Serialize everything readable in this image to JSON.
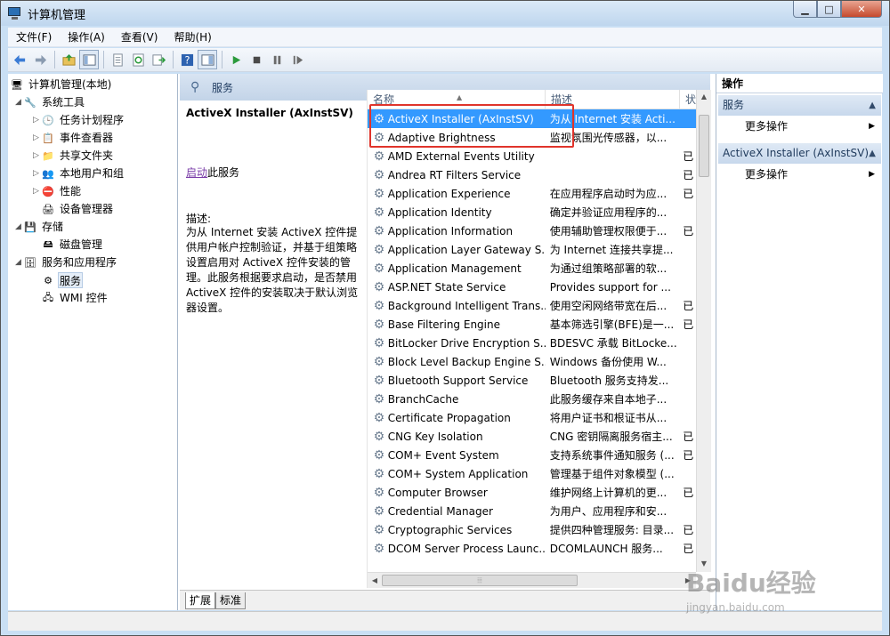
{
  "window": {
    "title": "计算机管理",
    "min_icon": "minimize-icon",
    "max_icon": "maximize-icon",
    "close_icon": "close-icon"
  },
  "menu": [
    "文件(F)",
    "操作(A)",
    "查看(V)",
    "帮助(H)"
  ],
  "toolbar_icons": [
    "back-icon",
    "forward-icon",
    "up-folder-icon",
    "show-tree-icon",
    "properties-icon",
    "refresh-icon",
    "export-icon",
    "help-icon",
    "view-icon",
    "start-service-icon",
    "stop-service-icon",
    "pause-service-icon",
    "restart-service-icon"
  ],
  "tree": {
    "root": "计算机管理(本地)",
    "items": [
      {
        "label": "系统工具",
        "icon": "tools-icon"
      },
      {
        "label": "任务计划程序",
        "icon": "clock-icon"
      },
      {
        "label": "事件查看器",
        "icon": "event-viewer-icon"
      },
      {
        "label": "共享文件夹",
        "icon": "shared-folder-icon"
      },
      {
        "label": "本地用户和组",
        "icon": "users-icon"
      },
      {
        "label": "性能",
        "icon": "performance-icon"
      },
      {
        "label": "设备管理器",
        "icon": "device-manager-icon"
      },
      {
        "label": "存储",
        "icon": "storage-icon"
      },
      {
        "label": "磁盘管理",
        "icon": "disk-icon"
      },
      {
        "label": "服务和应用程序",
        "icon": "services-apps-icon"
      },
      {
        "label": "服务",
        "icon": "services-icon"
      },
      {
        "label": "WMI 控件",
        "icon": "wmi-icon"
      }
    ]
  },
  "services_header": "服务",
  "description": {
    "title": "ActiveX Installer (AxInstSV)",
    "start_link": "启动",
    "start_suffix": "此服务",
    "label": "描述:",
    "body": "为从 Internet 安装 ActiveX 控件提供用户帐户控制验证，并基于组策略设置启用对 ActiveX 控件安装的管理。此服务根据要求启动，是否禁用 ActiveX 控件的安装取决于默认浏览器设置。"
  },
  "columns": {
    "name": "名称",
    "desc": "描述",
    "status": "状"
  },
  "services": [
    {
      "name": "ActiveX Installer (AxInstSV)",
      "desc": "为从 Internet 安装 Acti...",
      "status": ""
    },
    {
      "name": "Adaptive Brightness",
      "desc": "监视氛围光传感器，以...",
      "status": ""
    },
    {
      "name": "AMD External Events Utility",
      "desc": "",
      "status": "已"
    },
    {
      "name": "Andrea RT Filters Service",
      "desc": "",
      "status": "已"
    },
    {
      "name": "Application Experience",
      "desc": "在应用程序启动时为应...",
      "status": "已"
    },
    {
      "name": "Application Identity",
      "desc": "确定并验证应用程序的...",
      "status": ""
    },
    {
      "name": "Application Information",
      "desc": "使用辅助管理权限便于...",
      "status": "已"
    },
    {
      "name": "Application Layer Gateway S...",
      "desc": "为 Internet 连接共享提...",
      "status": ""
    },
    {
      "name": "Application Management",
      "desc": "为通过组策略部署的软...",
      "status": ""
    },
    {
      "name": "ASP.NET State Service",
      "desc": "Provides support for ...",
      "status": ""
    },
    {
      "name": "Background Intelligent Trans...",
      "desc": "使用空闲网络带宽在后...",
      "status": "已"
    },
    {
      "name": "Base Filtering Engine",
      "desc": "基本筛选引擎(BFE)是一...",
      "status": "已"
    },
    {
      "name": "BitLocker Drive Encryption S...",
      "desc": "BDESVC 承载 BitLocke...",
      "status": ""
    },
    {
      "name": "Block Level Backup Engine S...",
      "desc": "Windows 备份使用 W...",
      "status": ""
    },
    {
      "name": "Bluetooth Support Service",
      "desc": "Bluetooth 服务支持发...",
      "status": ""
    },
    {
      "name": "BranchCache",
      "desc": "此服务缓存来自本地子...",
      "status": ""
    },
    {
      "name": "Certificate Propagation",
      "desc": "将用户证书和根证书从...",
      "status": ""
    },
    {
      "name": "CNG Key Isolation",
      "desc": "CNG 密钥隔离服务宿主...",
      "status": "已"
    },
    {
      "name": "COM+ Event System",
      "desc": "支持系统事件通知服务 (...",
      "status": "已"
    },
    {
      "name": "COM+ System Application",
      "desc": "管理基于组件对象模型 (...",
      "status": ""
    },
    {
      "name": "Computer Browser",
      "desc": "维护网络上计算机的更...",
      "status": "已"
    },
    {
      "name": "Credential Manager",
      "desc": "为用户、应用程序和安...",
      "status": ""
    },
    {
      "name": "Cryptographic Services",
      "desc": "提供四种管理服务: 目录...",
      "status": "已"
    },
    {
      "name": "DCOM Server Process Launc...",
      "desc": "DCOMLAUNCH 服务...",
      "status": "已"
    }
  ],
  "tabs": [
    "扩展",
    "标准"
  ],
  "actions": {
    "title": "操作",
    "sections": [
      {
        "label": "服务",
        "item": "更多操作"
      },
      {
        "label": "ActiveX Installer (AxInstSV)",
        "item": "更多操作"
      }
    ]
  },
  "watermark": {
    "main": "Baidu经验",
    "sub": "jingyan.baidu.com"
  }
}
